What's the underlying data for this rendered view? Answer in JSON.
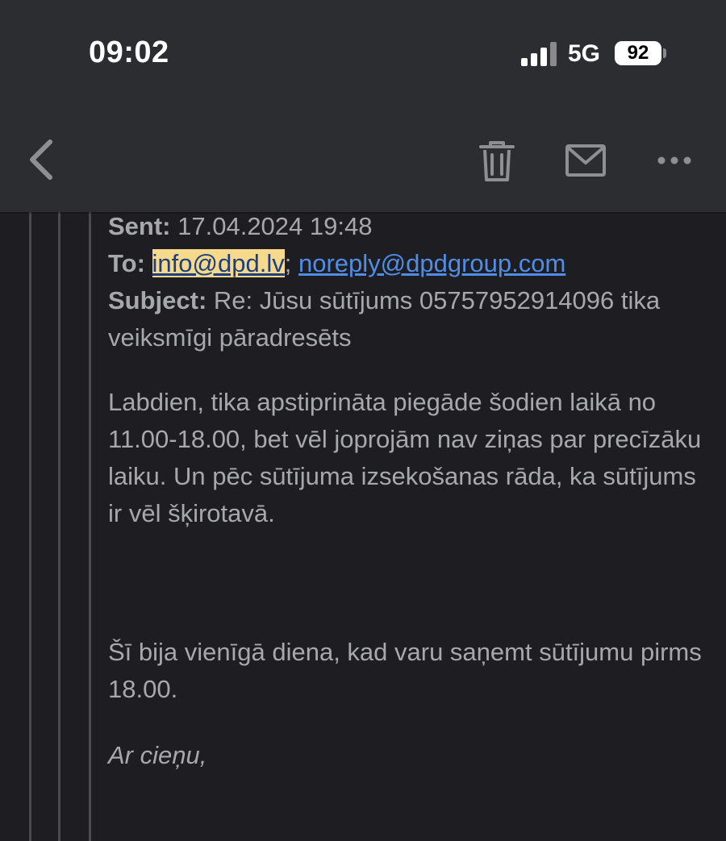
{
  "status_bar": {
    "time": "09:02",
    "network": "5G",
    "battery": "92"
  },
  "toolbar": {
    "back_icon": "chevron-left-icon",
    "trash_icon": "trash-icon",
    "mail_icon": "envelope-icon",
    "more_icon": "ellipsis-icon"
  },
  "email": {
    "sent_label": "Sent:",
    "sent_value": "17.04.2024 19:48",
    "to_label": "To:",
    "to_first": "info@dpd.lv",
    "to_separator": ";",
    "to_second": "noreply@dpdgroup.com",
    "subject_label": "Subject:",
    "subject_value": "Re: Jūsu sūtījums 05757952914096 tika veiksmīgi pāradresēts",
    "body_para_1": "Labdien, tika apstiprināta piegāde šodien laikā no 11.00-18.00, bet vēl joprojām nav ziņas par precīzāku laiku. Un pēc sūtījuma izsekošanas rāda, ka sūtījums ir vēl šķirotavā.",
    "body_para_2": "Šī bija vienīgā diena, kad varu saņemt sūtījumu pirms 18.00.",
    "signoff": "Ar cieņu,"
  },
  "colors": {
    "background": "#1e1e22",
    "toolbar": "#2c2d30",
    "text": "#a7a8ad",
    "link": "#4f8de6",
    "highlight": "#f6d98a"
  }
}
